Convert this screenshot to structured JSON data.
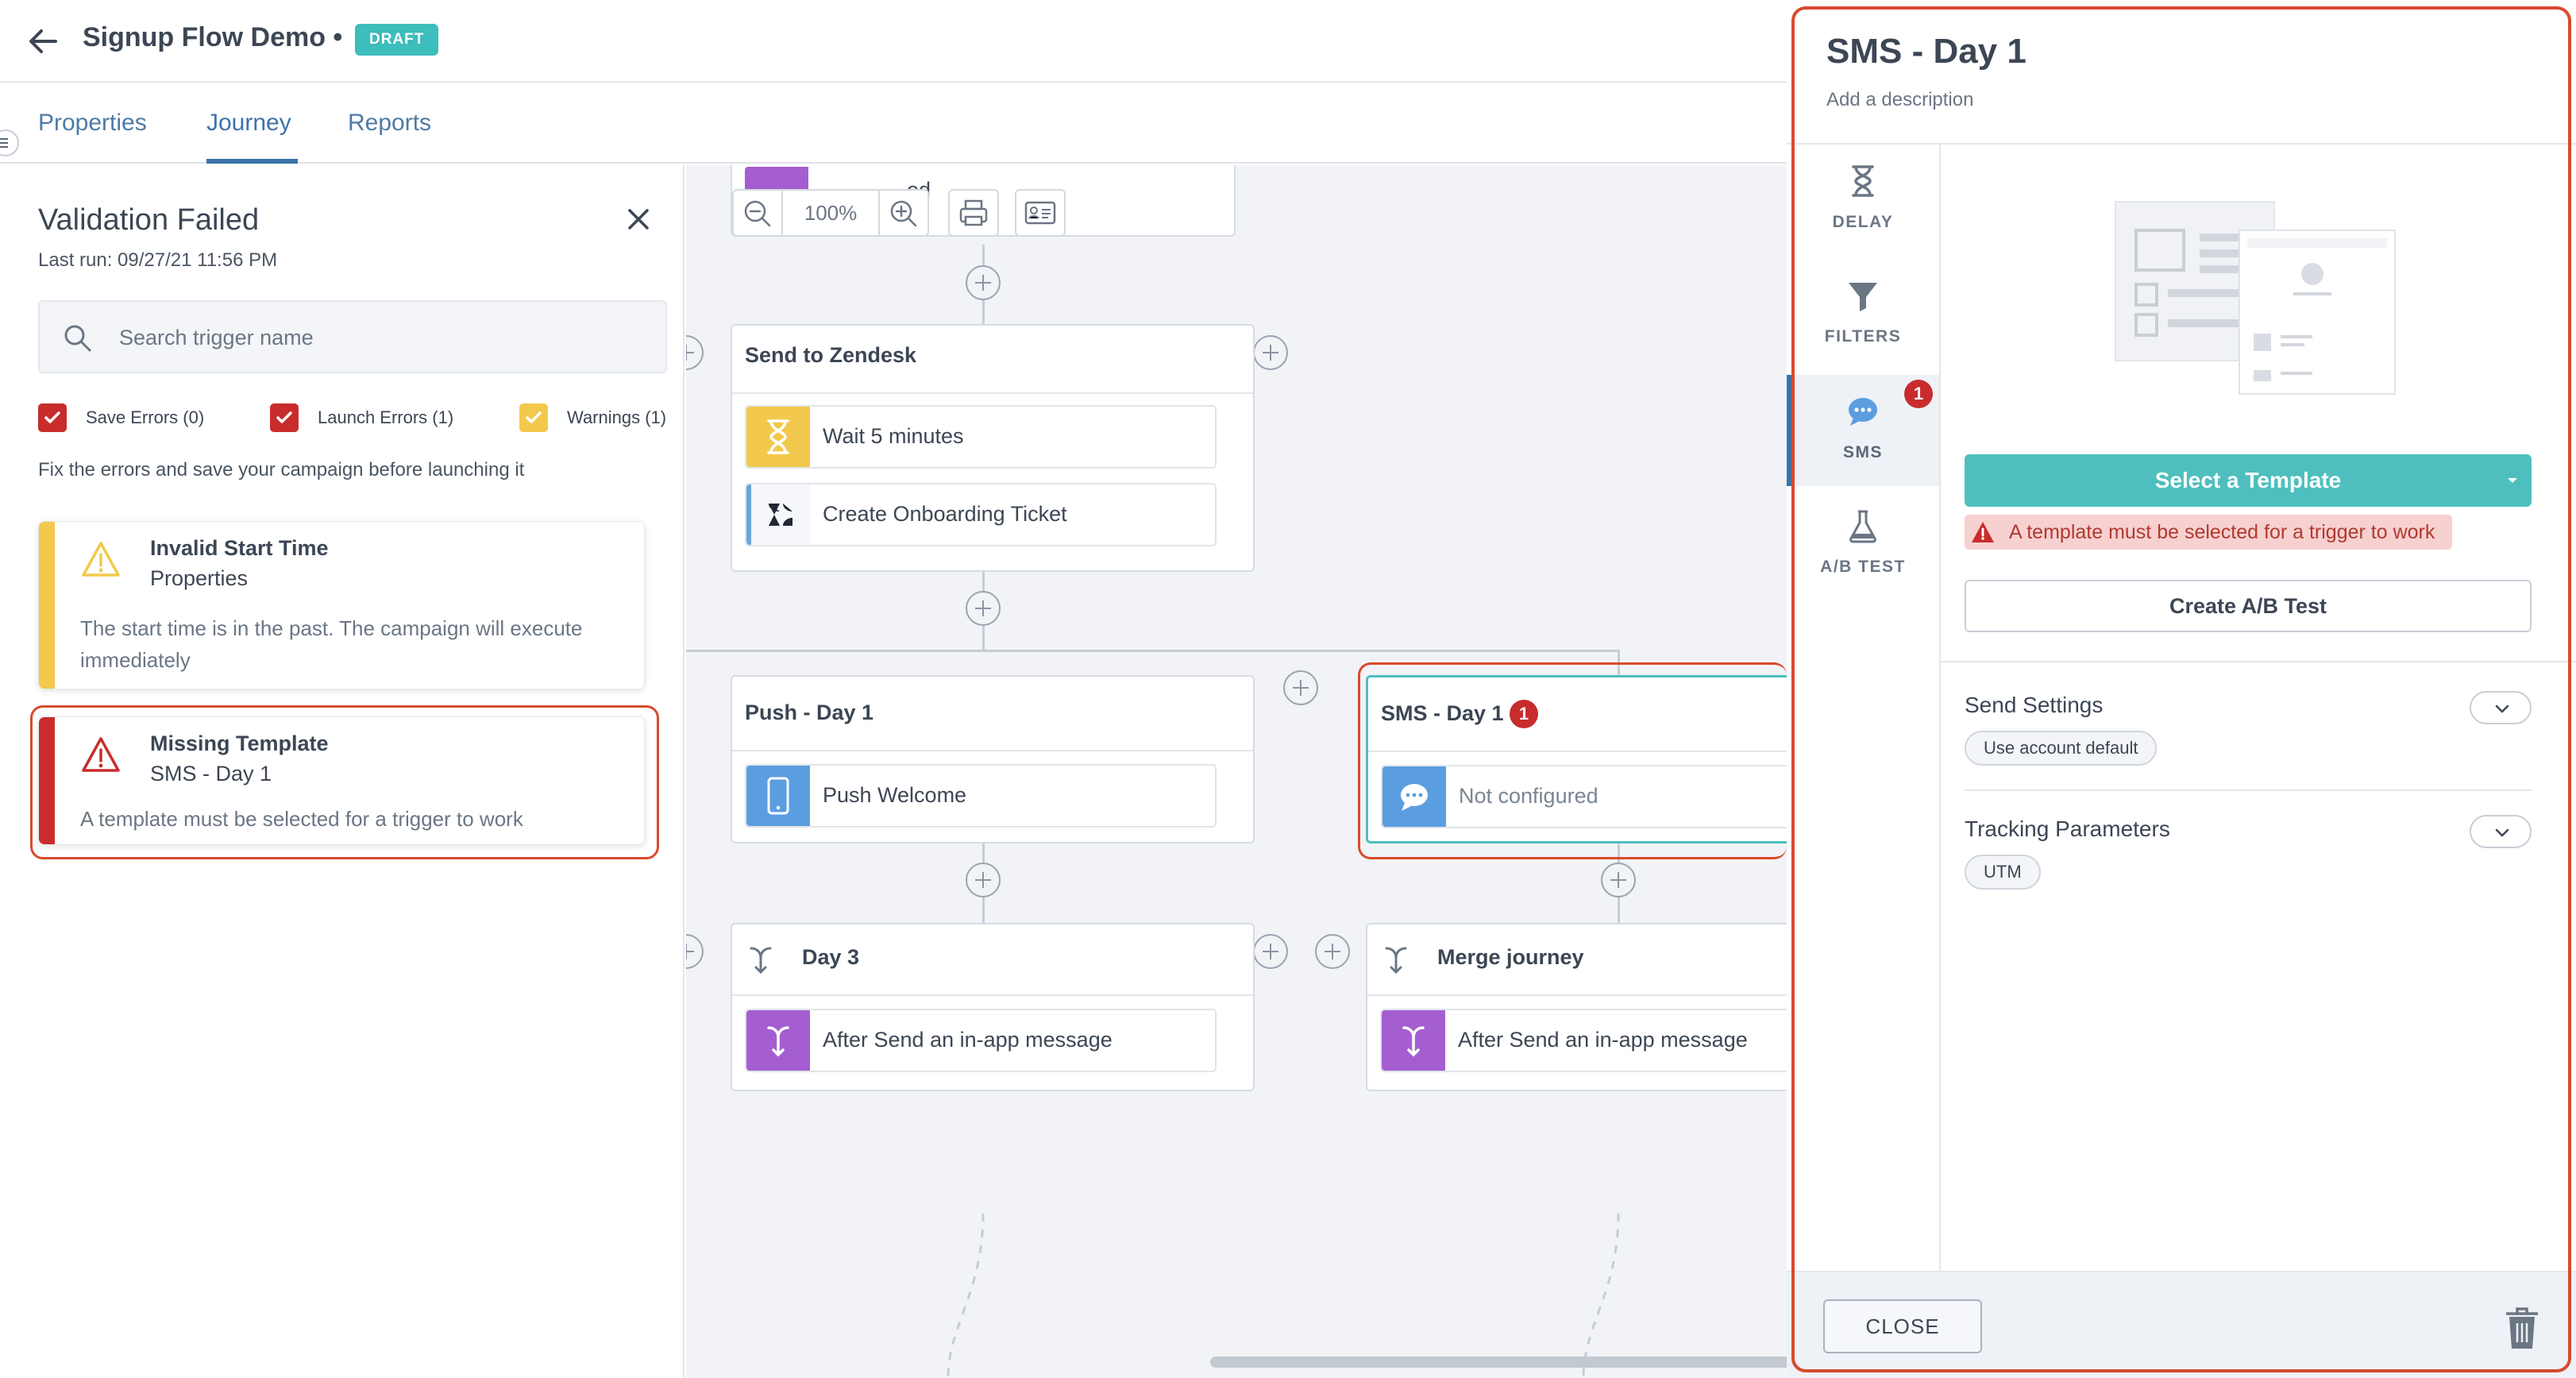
{
  "header": {
    "title": "Signup Flow Demo •",
    "status": "DRAFT"
  },
  "tabs": [
    {
      "label": "Properties"
    },
    {
      "label": "Journey"
    },
    {
      "label": "Reports"
    }
  ],
  "validation": {
    "title": "Validation Failed",
    "last_run": "Last run: 09/27/21 11:56 PM",
    "search_placeholder": "Search trigger name",
    "filters": [
      {
        "label": "Save Errors (0)",
        "checked": true,
        "color": "#c82c2c"
      },
      {
        "label": "Launch Errors (1)",
        "checked": true,
        "color": "#c82c2c"
      },
      {
        "label": "Warnings (1)",
        "checked": true,
        "color": "#f2c94c"
      }
    ],
    "hint": "Fix the errors and save your campaign before launching it",
    "items": [
      {
        "title": "Invalid Start Time",
        "subtitle": "Properties",
        "description": "The start time is in the past. The campaign will execute immediately",
        "severity": "warning",
        "icon": "warning-icon"
      },
      {
        "title": "Missing Template",
        "subtitle": "SMS - Day 1",
        "description": "A template must be selected for a trigger to work",
        "severity": "error",
        "icon": "error-icon"
      }
    ]
  },
  "canvas": {
    "zoom": "100%",
    "top_node_partial_label": "ed",
    "nodes": {
      "zendesk": {
        "title": "Send to Zendesk",
        "rows": [
          "Wait 5 minutes",
          "Create Onboarding Ticket"
        ]
      },
      "push": {
        "title": "Push - Day 1",
        "rows": [
          "Push Welcome"
        ]
      },
      "sms": {
        "title": "SMS - Day 1",
        "badge": "1",
        "rows": [
          "Not configured"
        ]
      },
      "day3": {
        "title": "Day 3",
        "rows": [
          "After Send an in-app message"
        ]
      },
      "merge": {
        "title": "Merge journey",
        "rows": [
          "After Send an in-app message"
        ]
      }
    }
  },
  "config": {
    "title": "SMS - Day 1",
    "description_placeholder": "Add a description",
    "rail": [
      {
        "label": "DELAY",
        "icon": "hourglass-icon"
      },
      {
        "label": "FILTERS",
        "icon": "filter-icon"
      },
      {
        "label": "SMS",
        "icon": "chat-bubble-icon",
        "badge": "1",
        "active": true
      },
      {
        "label": "A/B TEST",
        "icon": "flask-icon"
      }
    ],
    "select_template": "Select a Template",
    "template_error": "A template must be selected for a trigger to work",
    "ab_test": "Create A/B Test",
    "send_settings": {
      "title": "Send Settings",
      "value": "Use account default"
    },
    "tracking": {
      "title": "Tracking Parameters",
      "value": "UTM"
    },
    "close": "CLOSE"
  },
  "colors": {
    "accent": "#3d73a8",
    "teal": "#4ebfbe",
    "error": "#c82c2c",
    "warning": "#f2c94c",
    "highlight_outline": "#d94a2f"
  }
}
